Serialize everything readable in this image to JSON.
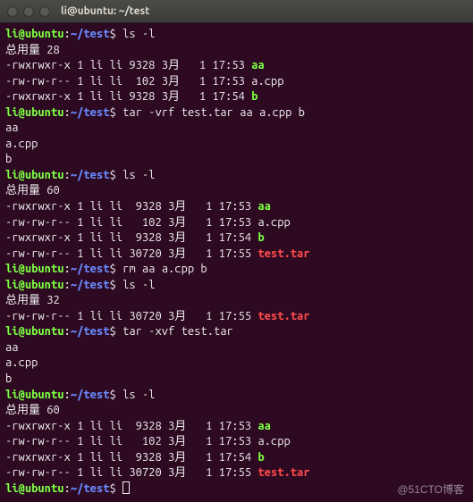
{
  "window": {
    "title": "li@ubuntu: ~/test"
  },
  "prompt": {
    "user": "li@ubuntu",
    "sep": ":",
    "path": "~/test",
    "dollar": "$"
  },
  "watermark": "@51CTO博客",
  "blocks": [
    {
      "cmd": "ls -l",
      "lines": [
        {
          "t": "plain",
          "text": "总用量 28"
        },
        {
          "t": "ls",
          "perm": "-rwxrwxr-x 1 li li 9328 3月   1 17:53 ",
          "name": "aa",
          "cls": "g"
        },
        {
          "t": "ls",
          "perm": "-rw-rw-r-- 1 li li  102 3月   1 17:53 ",
          "name": "a.cpp",
          "cls": ""
        },
        {
          "t": "ls",
          "perm": "-rwxrwxr-x 1 li li 9328 3月   1 17:54 ",
          "name": "b",
          "cls": "g"
        }
      ]
    },
    {
      "cmd": "tar -vrf test.tar aa a.cpp b",
      "lines": [
        {
          "t": "plain",
          "text": "aa"
        },
        {
          "t": "plain",
          "text": "a.cpp"
        },
        {
          "t": "plain",
          "text": "b"
        }
      ]
    },
    {
      "cmd": "ls -l",
      "lines": [
        {
          "t": "plain",
          "text": "总用量 60"
        },
        {
          "t": "ls",
          "perm": "-rwxrwxr-x 1 li li  9328 3月   1 17:53 ",
          "name": "aa",
          "cls": "g"
        },
        {
          "t": "ls",
          "perm": "-rw-rw-r-- 1 li li   102 3月   1 17:53 ",
          "name": "a.cpp",
          "cls": ""
        },
        {
          "t": "ls",
          "perm": "-rwxrwxr-x 1 li li  9328 3月   1 17:54 ",
          "name": "b",
          "cls": "g"
        },
        {
          "t": "ls",
          "perm": "-rw-rw-r-- 1 li li 30720 3月   1 17:55 ",
          "name": "test.tar",
          "cls": "r"
        }
      ]
    },
    {
      "cmd": "rm aa a.cpp b",
      "lines": []
    },
    {
      "cmd": "ls -l",
      "lines": [
        {
          "t": "plain",
          "text": "总用量 32"
        },
        {
          "t": "ls",
          "perm": "-rw-rw-r-- 1 li li 30720 3月   1 17:55 ",
          "name": "test.tar",
          "cls": "r"
        }
      ]
    },
    {
      "cmd": "tar -xvf test.tar",
      "lines": [
        {
          "t": "plain",
          "text": "aa"
        },
        {
          "t": "plain",
          "text": "a.cpp"
        },
        {
          "t": "plain",
          "text": "b"
        }
      ]
    },
    {
      "cmd": "ls -l",
      "lines": [
        {
          "t": "plain",
          "text": "总用量 60"
        },
        {
          "t": "ls",
          "perm": "-rwxrwxr-x 1 li li  9328 3月   1 17:53 ",
          "name": "aa",
          "cls": "g"
        },
        {
          "t": "ls",
          "perm": "-rw-rw-r-- 1 li li   102 3月   1 17:53 ",
          "name": "a.cpp",
          "cls": ""
        },
        {
          "t": "ls",
          "perm": "-rwxrwxr-x 1 li li  9328 3月   1 17:54 ",
          "name": "b",
          "cls": "g"
        },
        {
          "t": "ls",
          "perm": "-rw-rw-r-- 1 li li 30720 3月   1 17:55 ",
          "name": "test.tar",
          "cls": "r"
        }
      ]
    },
    {
      "cmd": "",
      "cursor": true,
      "lines": []
    }
  ]
}
